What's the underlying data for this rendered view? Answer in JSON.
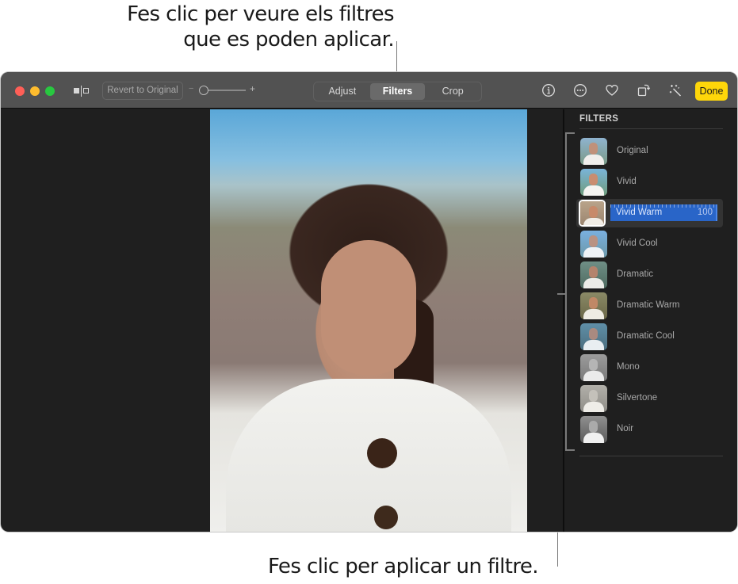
{
  "callouts": {
    "top_line1": "Fes clic per veure els filtres",
    "top_line2": "que es poden aplicar.",
    "bottom": "Fes clic per aplicar un filtre."
  },
  "toolbar": {
    "window_controls": [
      "close",
      "minimize",
      "zoom"
    ],
    "compare_icon": "split-compare-icon",
    "revert_label": "Revert to Original",
    "zoom_minus": "−",
    "zoom_plus": "+",
    "zoom_level": 0,
    "tabs": [
      {
        "label": "Adjust",
        "active": false
      },
      {
        "label": "Filters",
        "active": true
      },
      {
        "label": "Crop",
        "active": false
      }
    ],
    "icons": [
      "info-icon",
      "more-icon",
      "heart-icon",
      "rotate-icon",
      "auto-enhance-icon"
    ],
    "done_label": "Done",
    "accent": "#fed60a"
  },
  "sidebar": {
    "title": "FILTERS",
    "filters": [
      {
        "label": "Original",
        "selected": false
      },
      {
        "label": "Vivid",
        "selected": false
      },
      {
        "label": "Vivid Warm",
        "selected": true,
        "intensity": "100"
      },
      {
        "label": "Vivid Cool",
        "selected": false
      },
      {
        "label": "Dramatic",
        "selected": false
      },
      {
        "label": "Dramatic Warm",
        "selected": false
      },
      {
        "label": "Dramatic Cool",
        "selected": false
      },
      {
        "label": "Mono",
        "selected": false
      },
      {
        "label": "Silvertone",
        "selected": false
      },
      {
        "label": "Noir",
        "selected": false
      }
    ],
    "selection_color": "#2965c8"
  }
}
